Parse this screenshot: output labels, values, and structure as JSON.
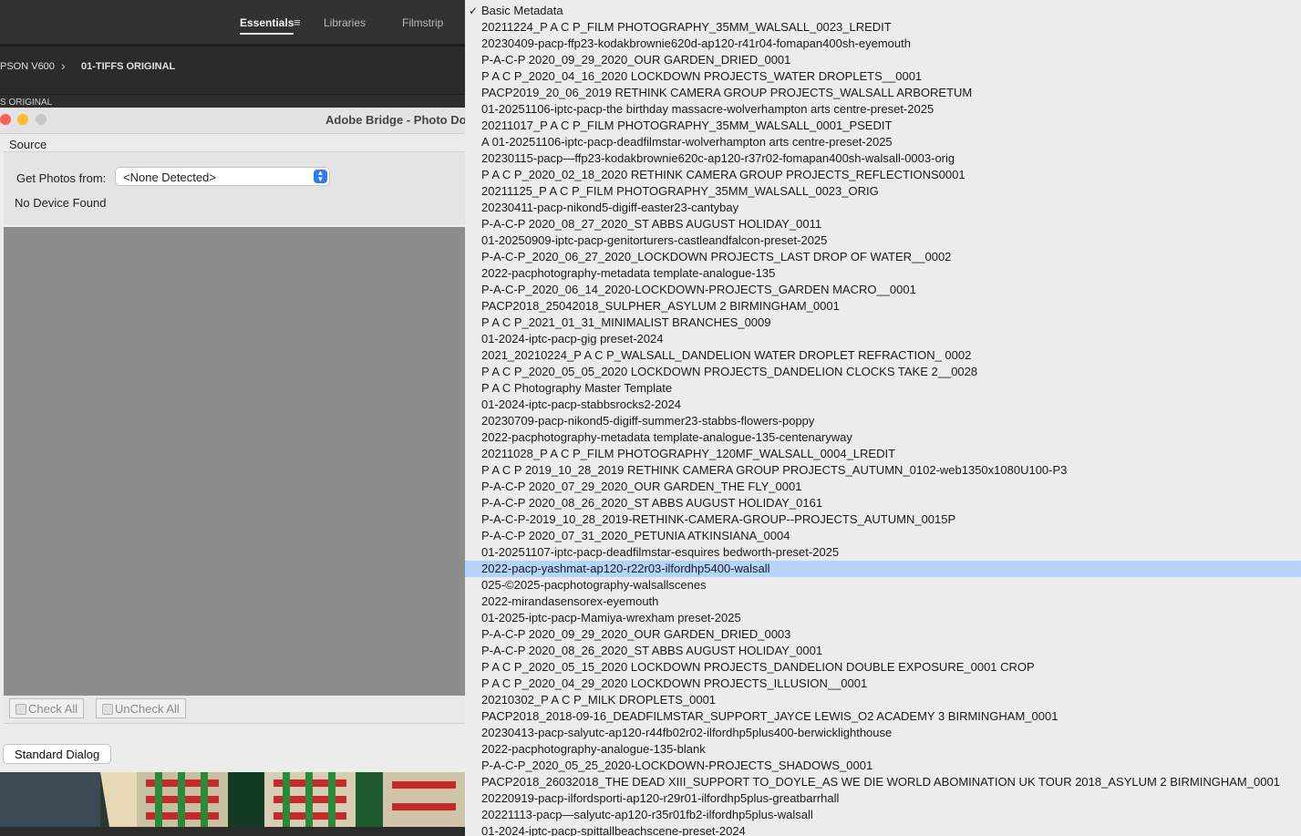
{
  "bridge": {
    "workspace_tabs": [
      "Essentials",
      "Libraries",
      "Filmstrip"
    ],
    "workspace_menu_glyph": "≡",
    "path_prefix": "PSON V600",
    "path_current": "01-TIFFS ORIGINAL",
    "path_sub": "S ORIGINAL"
  },
  "dialog": {
    "title": "Adobe Bridge - Photo Downloader",
    "source_label": "Source",
    "get_photos_label": "Get Photos from:",
    "get_photos_value": "<None Detected>",
    "no_device": "No Device Found",
    "check_all": "Check All",
    "uncheck_all": "UnCheck All",
    "standard_dialog": "Standard Dialog"
  },
  "menu": {
    "items": [
      "Basic Metadata",
      "20211224_P A C P_FILM PHOTOGRAPHY_35MM_WALSALL_0023_LREDIT",
      "20230409-pacp-ffp23-kodakbrownie620d-ap120-r41r04-fomapan400sh-eyemouth",
      "P-A-C-P 2020_09_29_2020_OUR GARDEN_DRIED_0001",
      "P A C P_2020_04_16_2020 LOCKDOWN PROJECTS_WATER DROPLETS__0001",
      "PACP2019_20_06_2019 RETHINK CAMERA GROUP  PROJECTS_WALSALL ARBORETUM",
      "01-20251106-iptc-pacp-the birthday massacre-wolverhampton arts centre-preset-2025",
      "20211017_P A C P_FILM PHOTOGRAPHY_35MM_WALSALL_0001_PSEDIT",
      "A 01-20251106-iptc-pacp-deadfilmstar-wolverhampton arts centre-preset-2025",
      "20230115-pacp—ffp23-kodakbrownie620c-ap120-r37r02-fomapan400sh-walsall-0003-orig",
      "P A C P_2020_02_18_2020 RETHINK CAMERA GROUP  PROJECTS_REFLECTIONS0001",
      "20211125_P A C P_FILM PHOTOGRAPHY_35MM_WALSALL_0023_ORIG",
      "20230411-pacp-nikond5-digiff-easter23-cantybay",
      "P-A-C-P 2020_08_27_2020_ST ABBS AUGUST HOLIDAY_0011",
      "01-20250909-iptc-pacp-genitorturers-castleandfalcon-preset-2025",
      "P-A-C-P_2020_06_27_2020_LOCKDOWN PROJECTS_LAST DROP OF WATER__0002",
      "2022-pacphotography-metadata template-analogue-135",
      "P-A-C-P_2020_06_14_2020-LOCKDOWN-PROJECTS_GARDEN MACRO__0001",
      "PACP2018_25042018_SULPHER_ASYLUM 2 BIRMINGHAM_0001",
      "P A C P_2021_01_31_MINIMALIST BRANCHES_0009",
      "01-2024-iptc-pacp-gig preset-2024",
      "2021_20210224_P A C P_WALSALL_DANDELION WATER DROPLET REFRACTION_ 0002",
      "P A C P_2020_05_05_2020 LOCKDOWN PROJECTS_DANDELION CLOCKS TAKE 2__0028",
      "P A C Photography Master Template",
      "01-2024-iptc-pacp-stabbsrocks2-2024",
      "20230709-pacp-nikond5-digiff-summer23-stabbs-flowers-poppy",
      "2022-pacphotography-metadata template-analogue-135-centenaryway",
      "20211028_P A C P_FILM PHOTOGRAPHY_120MF_WALSALL_0004_LREDIT",
      "P A C P 2019_10_28_2019 RETHINK CAMERA GROUP  PROJECTS_AUTUMN_0102-web1350x1080U100-P3",
      "P-A-C-P 2020_07_29_2020_OUR GARDEN_THE FLY_0001",
      "P-A-C-P 2020_08_26_2020_ST ABBS AUGUST HOLIDAY_0161",
      "P-A-C-P-2019_10_28_2019-RETHINK-CAMERA-GROUP--PROJECTS_AUTUMN_0015P",
      "P-A-C-P 2020_07_31_2020_PETUNIA ATKINSIANA_0004",
      "01-20251107-iptc-pacp-deadfilmstar-esquires bedworth-preset-2025",
      "2022-pacp-yashmat-ap120-r22r03-ilfordhp5400-walsall",
      "025-©2025-pacphotography-walsallscenes",
      "2022-mirandasensorex-eyemouth",
      "01-2025-iptc-pacp-Mamiya-wrexham preset-2025",
      "P-A-C-P 2020_09_29_2020_OUR GARDEN_DRIED_0003",
      "P-A-C-P 2020_08_26_2020_ST ABBS AUGUST HOLIDAY_0001",
      "P A C P_2020_05_15_2020 LOCKDOWN PROJECTS_DANDELION DOUBLE EXPOSURE_0001 CROP",
      "P A C P_2020_04_29_2020 LOCKDOWN PROJECTS_ILLUSION__0001",
      "20210302_P A C P_MILK DROPLETS_0001",
      "PACP2018_2018-09-16_DEADFILMSTAR_SUPPORT_JAYCE LEWIS_O2 ACADEMY 3 BIRMINGHAM_0001",
      "20230413-pacp-salyutc-ap120-r44fb02r02-ilfordhp5plus400-berwicklighthouse",
      "2022-pacphotography-analogue-135-blank",
      "P-A-C-P_2020_05_25_2020-LOCKDOWN-PROJECTS_SHADOWS_0001",
      "PACP2018_26032018_THE DEAD XIII_SUPPORT TO_DOYLE_AS WE DIE WORLD ABOMINATION UK TOUR 2018_ASYLUM 2 BIRMINGHAM_0001",
      "20220919-pacp-ilfordsporti-ap120-r29r01-ilfordhp5plus-greatbarrhall",
      "20221113-pacp—salyutc-ap120-r35r01fb2-ilfordhp5plus-walsall",
      "01-2024-iptc-pacp-spittallbeachscene-preset-2024"
    ],
    "checked_index": 0,
    "highlighted_index": 34,
    "check_glyph": "✓"
  }
}
